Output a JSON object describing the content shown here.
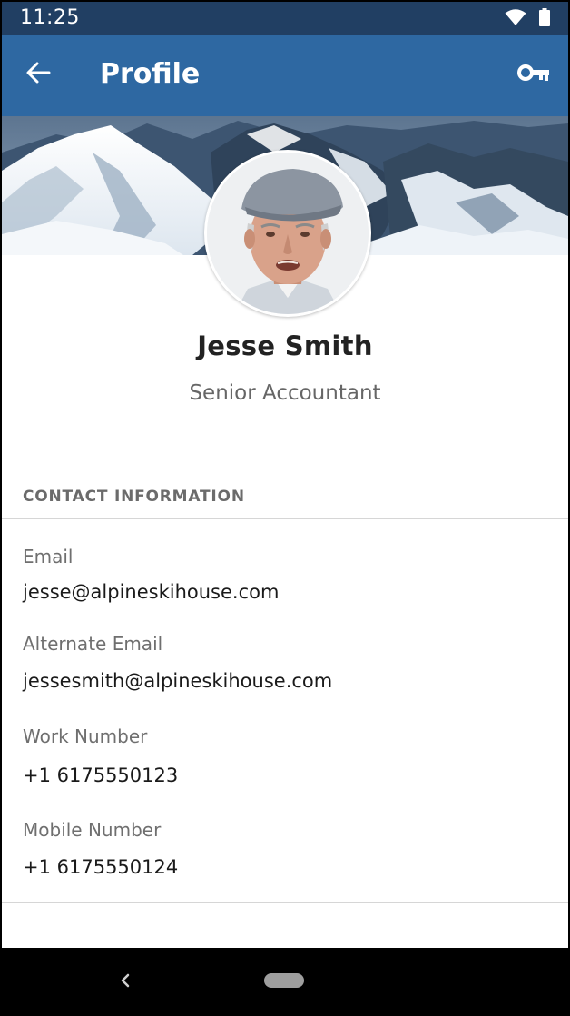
{
  "status_bar": {
    "time": "11:25",
    "icons": [
      "wifi-icon",
      "battery-icon"
    ]
  },
  "app_bar": {
    "title": "Profile",
    "back_icon": "arrow-back-icon",
    "action_icon": "key-icon"
  },
  "profile": {
    "name": "Jesse Smith",
    "job_title": "Senior Accountant"
  },
  "contact": {
    "header": "CONTACT INFORMATION",
    "fields": [
      {
        "label": "Email",
        "value": "jesse@alpineskihouse.com"
      },
      {
        "label": "Alternate Email",
        "value": "jessesmith@alpineskihouse.com"
      },
      {
        "label": "Work Number",
        "value": "+1 6175550123"
      },
      {
        "label": "Mobile Number",
        "value": "+1 6175550124"
      }
    ]
  },
  "colors": {
    "status_bar": "#213f63",
    "app_bar": "#2e68a2",
    "nav_bar": "#000000"
  }
}
